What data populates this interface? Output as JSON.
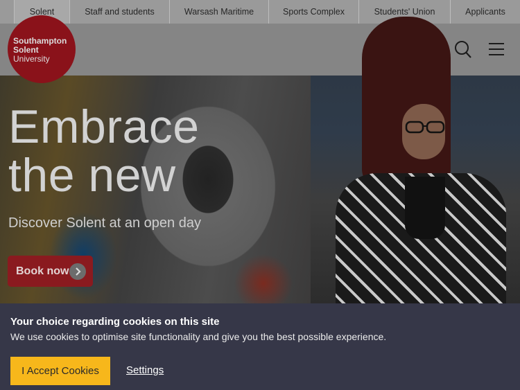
{
  "topnav": {
    "items": [
      {
        "label": "Solent",
        "active": true
      },
      {
        "label": "Staff and students",
        "active": false
      },
      {
        "label": "Warsash Maritime",
        "active": false
      },
      {
        "label": "Sports Complex",
        "active": false
      },
      {
        "label": "Students' Union",
        "active": false
      },
      {
        "label": "Applicants",
        "active": false
      }
    ]
  },
  "header": {
    "logo": {
      "line1": "Southampton",
      "line2": "Solent",
      "line3": "University"
    },
    "icons": [
      "search-icon",
      "menu-icon"
    ]
  },
  "hero": {
    "title_line1": "Embrace",
    "title_line2": "the new",
    "subtitle": "Discover Solent at an open day",
    "cta_label": "Book now"
  },
  "cookie_banner": {
    "heading": "Your choice regarding cookies on this site",
    "text": "We use cookies to optimise site functionality and give you the best possible experience.",
    "accept_label": "I Accept Cookies",
    "settings_label": "Settings"
  },
  "colors": {
    "brand_red": "#8a121a",
    "accept_yellow": "#f7b71b",
    "banner_bg": "#363748"
  }
}
